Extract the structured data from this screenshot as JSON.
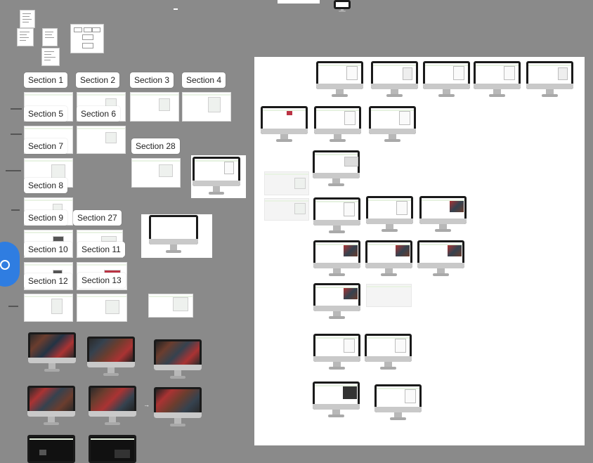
{
  "sections": {
    "s1": "Section 1",
    "s2": "Section 2",
    "s3": "Section 3",
    "s4": "Section 4",
    "s5": "Section 5",
    "s6": "Section 6",
    "s7": "Section 7",
    "s8": "Section 8",
    "s9": "Section 9",
    "s10": "Section 10",
    "s11": "Section 11",
    "s12": "Section 12",
    "s13": "Section 13",
    "s27": "Section 27",
    "s28": "Section 28"
  },
  "arrow": "→",
  "icons": {
    "avatar": "user-avatar-icon",
    "monitor": "monitor-icon"
  },
  "colors": {
    "board": "#8a8a8a",
    "canvas": "#ffffff",
    "accent_green": "#e6f2e0",
    "avatar_blue": "#2f7de1"
  }
}
